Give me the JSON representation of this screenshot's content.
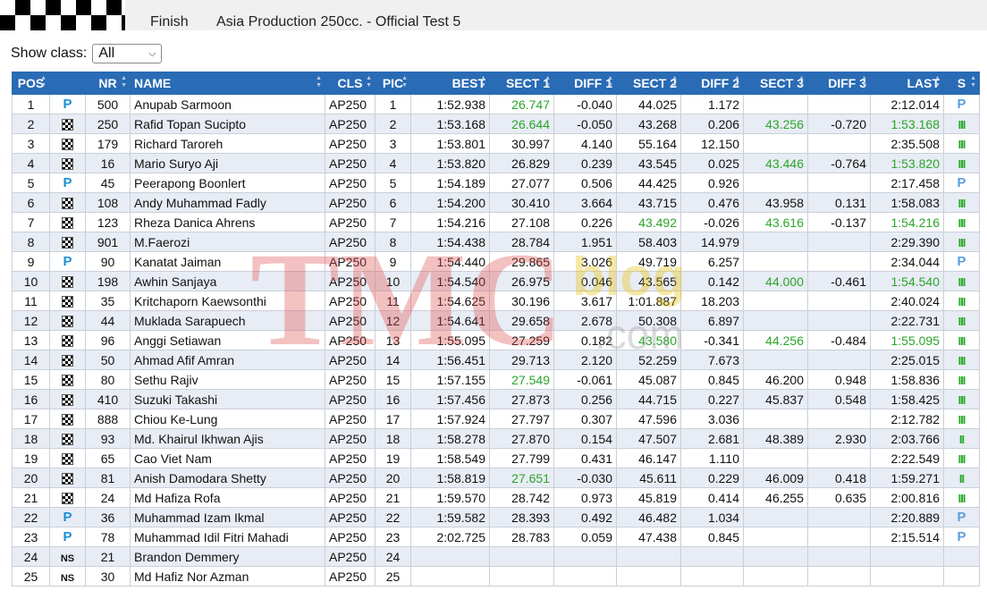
{
  "header": {
    "status": "Finish",
    "session_title": "Asia Production 250cc. - Official Test 5"
  },
  "filter": {
    "label": "Show class:",
    "selected": "All"
  },
  "columns": [
    "POS",
    "",
    "NR",
    "NAME",
    "CLS",
    "PIC",
    "BEST",
    "SECT 1",
    "DIFF 1",
    "SECT 2",
    "DIFF 2",
    "SECT 3",
    "DIFF 3",
    "LAST",
    "S"
  ],
  "rows": [
    {
      "pos": "1",
      "icon": "p",
      "nr": "500",
      "name": "Anupab Sarmoon",
      "cls": "AP250",
      "pic": "1",
      "best": "1:52.938",
      "s1": "26.747",
      "s1g": true,
      "d1": "-0.040",
      "s2": "44.025",
      "s2g": false,
      "d2": "1.172",
      "s3": "",
      "s3g": false,
      "d3": "",
      "last": "2:12.014",
      "lastg": false,
      "st": "P"
    },
    {
      "pos": "2",
      "icon": "flag",
      "nr": "250",
      "name": "Rafid Topan Sucipto",
      "cls": "AP250",
      "pic": "2",
      "best": "1:53.168",
      "s1": "26.644",
      "s1g": true,
      "d1": "-0.050",
      "s2": "43.268",
      "s2g": false,
      "d2": "0.206",
      "s3": "43.256",
      "s3g": true,
      "d3": "-0.720",
      "last": "1:53.168",
      "lastg": true,
      "st": "III"
    },
    {
      "pos": "3",
      "icon": "flag",
      "nr": "179",
      "name": "Richard Taroreh",
      "cls": "AP250",
      "pic": "3",
      "best": "1:53.801",
      "s1": "30.997",
      "s1g": false,
      "d1": "4.140",
      "s2": "55.164",
      "s2g": false,
      "d2": "12.150",
      "s3": "",
      "s3g": false,
      "d3": "",
      "last": "2:35.508",
      "lastg": false,
      "st": "III"
    },
    {
      "pos": "4",
      "icon": "flag",
      "nr": "16",
      "name": "Mario Suryo Aji",
      "cls": "AP250",
      "pic": "4",
      "best": "1:53.820",
      "s1": "26.829",
      "s1g": false,
      "d1": "0.239",
      "s2": "43.545",
      "s2g": false,
      "d2": "0.025",
      "s3": "43.446",
      "s3g": true,
      "d3": "-0.764",
      "last": "1:53.820",
      "lastg": true,
      "st": "III"
    },
    {
      "pos": "5",
      "icon": "p",
      "nr": "45",
      "name": "Peerapong Boonlert",
      "cls": "AP250",
      "pic": "5",
      "best": "1:54.189",
      "s1": "27.077",
      "s1g": false,
      "d1": "0.506",
      "s2": "44.425",
      "s2g": false,
      "d2": "0.926",
      "s3": "",
      "s3g": false,
      "d3": "",
      "last": "2:17.458",
      "lastg": false,
      "st": "P"
    },
    {
      "pos": "6",
      "icon": "flag",
      "nr": "108",
      "name": "Andy Muhammad Fadly",
      "cls": "AP250",
      "pic": "6",
      "best": "1:54.200",
      "s1": "30.410",
      "s1g": false,
      "d1": "3.664",
      "s2": "43.715",
      "s2g": false,
      "d2": "0.476",
      "s3": "43.958",
      "s3g": false,
      "d3": "0.131",
      "last": "1:58.083",
      "lastg": false,
      "st": "III"
    },
    {
      "pos": "7",
      "icon": "flag",
      "nr": "123",
      "name": "Rheza Danica Ahrens",
      "cls": "AP250",
      "pic": "7",
      "best": "1:54.216",
      "s1": "27.108",
      "s1g": false,
      "d1": "0.226",
      "s2": "43.492",
      "s2g": true,
      "d2": "-0.026",
      "s3": "43.616",
      "s3g": true,
      "d3": "-0.137",
      "last": "1:54.216",
      "lastg": true,
      "st": "III"
    },
    {
      "pos": "8",
      "icon": "flag",
      "nr": "901",
      "name": "M.Faerozi",
      "cls": "AP250",
      "pic": "8",
      "best": "1:54.438",
      "s1": "28.784",
      "s1g": false,
      "d1": "1.951",
      "s2": "58.403",
      "s2g": false,
      "d2": "14.979",
      "s3": "",
      "s3g": false,
      "d3": "",
      "last": "2:29.390",
      "lastg": false,
      "st": "III"
    },
    {
      "pos": "9",
      "icon": "p",
      "nr": "90",
      "name": "Kanatat Jaiman",
      "cls": "AP250",
      "pic": "9",
      "best": "1:54.440",
      "s1": "29.865",
      "s1g": false,
      "d1": "3.026",
      "s2": "49.719",
      "s2g": false,
      "d2": "6.257",
      "s3": "",
      "s3g": false,
      "d3": "",
      "last": "2:34.044",
      "lastg": false,
      "st": "P"
    },
    {
      "pos": "10",
      "icon": "flag",
      "nr": "198",
      "name": "Awhin Sanjaya",
      "cls": "AP250",
      "pic": "10",
      "best": "1:54.540",
      "s1": "26.975",
      "s1g": false,
      "d1": "0.046",
      "s2": "43.565",
      "s2g": false,
      "d2": "0.142",
      "s3": "44.000",
      "s3g": true,
      "d3": "-0.461",
      "last": "1:54.540",
      "lastg": true,
      "st": "III"
    },
    {
      "pos": "11",
      "icon": "flag",
      "nr": "35",
      "name": "Kritchaporn Kaewsonthi",
      "cls": "AP250",
      "pic": "11",
      "best": "1:54.625",
      "s1": "30.196",
      "s1g": false,
      "d1": "3.617",
      "s2": "1:01.887",
      "s2g": false,
      "d2": "18.203",
      "s3": "",
      "s3g": false,
      "d3": "",
      "last": "2:40.024",
      "lastg": false,
      "st": "III"
    },
    {
      "pos": "12",
      "icon": "flag",
      "nr": "44",
      "name": "Muklada Sarapuech",
      "cls": "AP250",
      "pic": "12",
      "best": "1:54.641",
      "s1": "29.658",
      "s1g": false,
      "d1": "2.678",
      "s2": "50.308",
      "s2g": false,
      "d2": "6.897",
      "s3": "",
      "s3g": false,
      "d3": "",
      "last": "2:22.731",
      "lastg": false,
      "st": "III"
    },
    {
      "pos": "13",
      "icon": "flag",
      "nr": "96",
      "name": "Anggi Setiawan",
      "cls": "AP250",
      "pic": "13",
      "best": "1:55.095",
      "s1": "27.259",
      "s1g": false,
      "d1": "0.182",
      "s2": "43.580",
      "s2g": true,
      "d2": "-0.341",
      "s3": "44.256",
      "s3g": true,
      "d3": "-0.484",
      "last": "1:55.095",
      "lastg": true,
      "st": "III"
    },
    {
      "pos": "14",
      "icon": "flag",
      "nr": "50",
      "name": "Ahmad Afif Amran",
      "cls": "AP250",
      "pic": "14",
      "best": "1:56.451",
      "s1": "29.713",
      "s1g": false,
      "d1": "2.120",
      "s2": "52.259",
      "s2g": false,
      "d2": "7.673",
      "s3": "",
      "s3g": false,
      "d3": "",
      "last": "2:25.015",
      "lastg": false,
      "st": "III"
    },
    {
      "pos": "15",
      "icon": "flag",
      "nr": "80",
      "name": "Sethu Rajiv",
      "cls": "AP250",
      "pic": "15",
      "best": "1:57.155",
      "s1": "27.549",
      "s1g": true,
      "d1": "-0.061",
      "s2": "45.087",
      "s2g": false,
      "d2": "0.845",
      "s3": "46.200",
      "s3g": false,
      "d3": "0.948",
      "last": "1:58.836",
      "lastg": false,
      "st": "III"
    },
    {
      "pos": "16",
      "icon": "flag",
      "nr": "410",
      "name": "Suzuki Takashi",
      "cls": "AP250",
      "pic": "16",
      "best": "1:57.456",
      "s1": "27.873",
      "s1g": false,
      "d1": "0.256",
      "s2": "44.715",
      "s2g": false,
      "d2": "0.227",
      "s3": "45.837",
      "s3g": false,
      "d3": "0.548",
      "last": "1:58.425",
      "lastg": false,
      "st": "III"
    },
    {
      "pos": "17",
      "icon": "flag",
      "nr": "888",
      "name": "Chiou Ke-Lung",
      "cls": "AP250",
      "pic": "17",
      "best": "1:57.924",
      "s1": "27.797",
      "s1g": false,
      "d1": "0.307",
      "s2": "47.596",
      "s2g": false,
      "d2": "3.036",
      "s3": "",
      "s3g": false,
      "d3": "",
      "last": "2:12.782",
      "lastg": false,
      "st": "III"
    },
    {
      "pos": "18",
      "icon": "flag",
      "nr": "93",
      "name": "Md. Khairul Ikhwan Ajis",
      "cls": "AP250",
      "pic": "18",
      "best": "1:58.278",
      "s1": "27.870",
      "s1g": false,
      "d1": "0.154",
      "s2": "47.507",
      "s2g": false,
      "d2": "2.681",
      "s3": "48.389",
      "s3g": false,
      "d3": "2.930",
      "last": "2:03.766",
      "lastg": false,
      "st": "II"
    },
    {
      "pos": "19",
      "icon": "flag",
      "nr": "65",
      "name": "Cao Viet Nam",
      "cls": "AP250",
      "pic": "19",
      "best": "1:58.549",
      "s1": "27.799",
      "s1g": false,
      "d1": "0.431",
      "s2": "46.147",
      "s2g": false,
      "d2": "1.110",
      "s3": "",
      "s3g": false,
      "d3": "",
      "last": "2:22.549",
      "lastg": false,
      "st": "III"
    },
    {
      "pos": "20",
      "icon": "flag",
      "nr": "81",
      "name": "Anish Damodara Shetty",
      "cls": "AP250",
      "pic": "20",
      "best": "1:58.819",
      "s1": "27.651",
      "s1g": true,
      "d1": "-0.030",
      "s2": "45.611",
      "s2g": false,
      "d2": "0.229",
      "s3": "46.009",
      "s3g": false,
      "d3": "0.418",
      "last": "1:59.271",
      "lastg": false,
      "st": "II"
    },
    {
      "pos": "21",
      "icon": "flag",
      "nr": "24",
      "name": "Md Hafiza Rofa",
      "cls": "AP250",
      "pic": "21",
      "best": "1:59.570",
      "s1": "28.742",
      "s1g": false,
      "d1": "0.973",
      "s2": "45.819",
      "s2g": false,
      "d2": "0.414",
      "s3": "46.255",
      "s3g": false,
      "d3": "0.635",
      "last": "2:00.816",
      "lastg": false,
      "st": "III"
    },
    {
      "pos": "22",
      "icon": "p",
      "nr": "36",
      "name": "Muhammad Izam Ikmal",
      "cls": "AP250",
      "pic": "22",
      "best": "1:59.582",
      "s1": "28.393",
      "s1g": false,
      "d1": "0.492",
      "s2": "46.482",
      "s2g": false,
      "d2": "1.034",
      "s3": "",
      "s3g": false,
      "d3": "",
      "last": "2:20.889",
      "lastg": false,
      "st": "P"
    },
    {
      "pos": "23",
      "icon": "p",
      "nr": "78",
      "name": "Muhammad Idil Fitri Mahadi",
      "cls": "AP250",
      "pic": "23",
      "best": "2:02.725",
      "s1": "28.783",
      "s1g": false,
      "d1": "0.059",
      "s2": "47.438",
      "s2g": false,
      "d2": "0.845",
      "s3": "",
      "s3g": false,
      "d3": "",
      "last": "2:15.514",
      "lastg": false,
      "st": "P"
    },
    {
      "pos": "24",
      "icon": "ns",
      "nr": "21",
      "name": "Brandon Demmery",
      "cls": "AP250",
      "pic": "24",
      "best": "",
      "s1": "",
      "s1g": false,
      "d1": "",
      "s2": "",
      "s2g": false,
      "d2": "",
      "s3": "",
      "s3g": false,
      "d3": "",
      "last": "",
      "lastg": false,
      "st": ""
    },
    {
      "pos": "25",
      "icon": "ns",
      "nr": "30",
      "name": "Md Hafiz Nor Azman",
      "cls": "AP250",
      "pic": "25",
      "best": "",
      "s1": "",
      "s1g": false,
      "d1": "",
      "s2": "",
      "s2g": false,
      "d2": "",
      "s3": "",
      "s3g": false,
      "d3": "",
      "last": "",
      "lastg": false,
      "st": ""
    }
  ],
  "icon_labels": {
    "p": "P",
    "ns": "NS"
  },
  "watermark": {
    "main": "TMC",
    "sub": "blog",
    "domain": ".com"
  },
  "colors": {
    "header_bg": "#2a6bb5",
    "green": "#2aa52a",
    "pit_blue": "#1a8fd6"
  }
}
